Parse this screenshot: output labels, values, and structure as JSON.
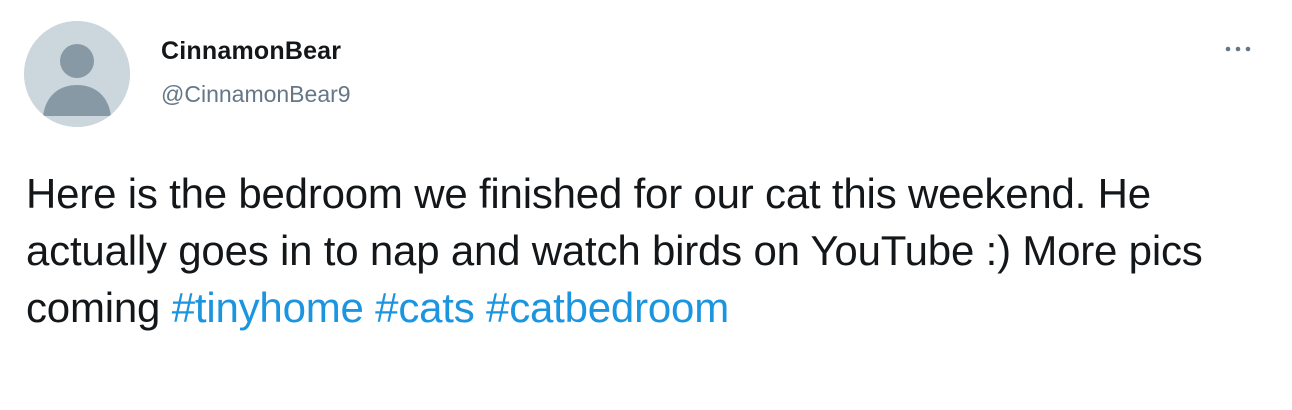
{
  "tweet": {
    "display_name": "CinnamonBear",
    "handle": "@CinnamonBear9",
    "text_parts": [
      "Here is the bedroom we finished for our cat this weekend. He actually goes in to nap and watch birds on YouTube :) More pics coming"
    ],
    "hashtags": [
      "#tinyhome",
      "#cats",
      "#catbedroom"
    ],
    "avatar_icon": "default-profile-icon",
    "more_icon": "more-dots-icon"
  },
  "colors": {
    "text": "#14171a",
    "secondary": "#657786",
    "hashtag": "#1b95e0",
    "avatar_bg": "#ccd6dd",
    "avatar_fg": "#8899a6"
  }
}
